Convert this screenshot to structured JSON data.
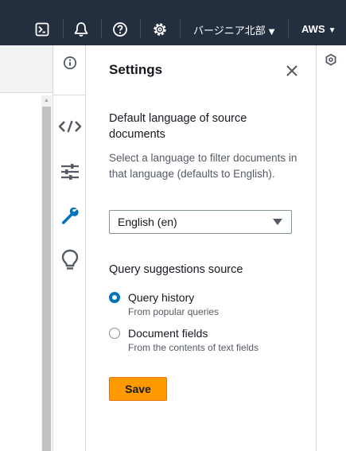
{
  "header": {
    "region_label": "バージニア北部",
    "account_label": "AWS",
    "caret": "▼"
  },
  "icons": {
    "cloudshell": "terminal-icon",
    "notifications": "bell-icon",
    "help": "help-circle-icon",
    "settings": "gear-icon",
    "rail": [
      "info-icon",
      "code-icon",
      "sliders-icon",
      "wrench-icon",
      "lightbulb-icon"
    ],
    "right": "hexagon-icon"
  },
  "colors": {
    "nav_bg": "#232f3e",
    "accent_orange": "#ff9900",
    "rail_active": "#0073bb",
    "radio_selected": "#0073bb"
  },
  "panel": {
    "title": "Settings",
    "language": {
      "label": "Default language of source documents",
      "description": "Select a language to filter documents in that language (defaults to English).",
      "selected": "English (en)"
    },
    "query": {
      "label": "Query suggestions source",
      "options": [
        {
          "label": "Query history",
          "description": "From popular queries",
          "selected": true
        },
        {
          "label": "Document fields",
          "description": "From the contents of text fields",
          "selected": false
        }
      ]
    },
    "save_label": "Save"
  }
}
